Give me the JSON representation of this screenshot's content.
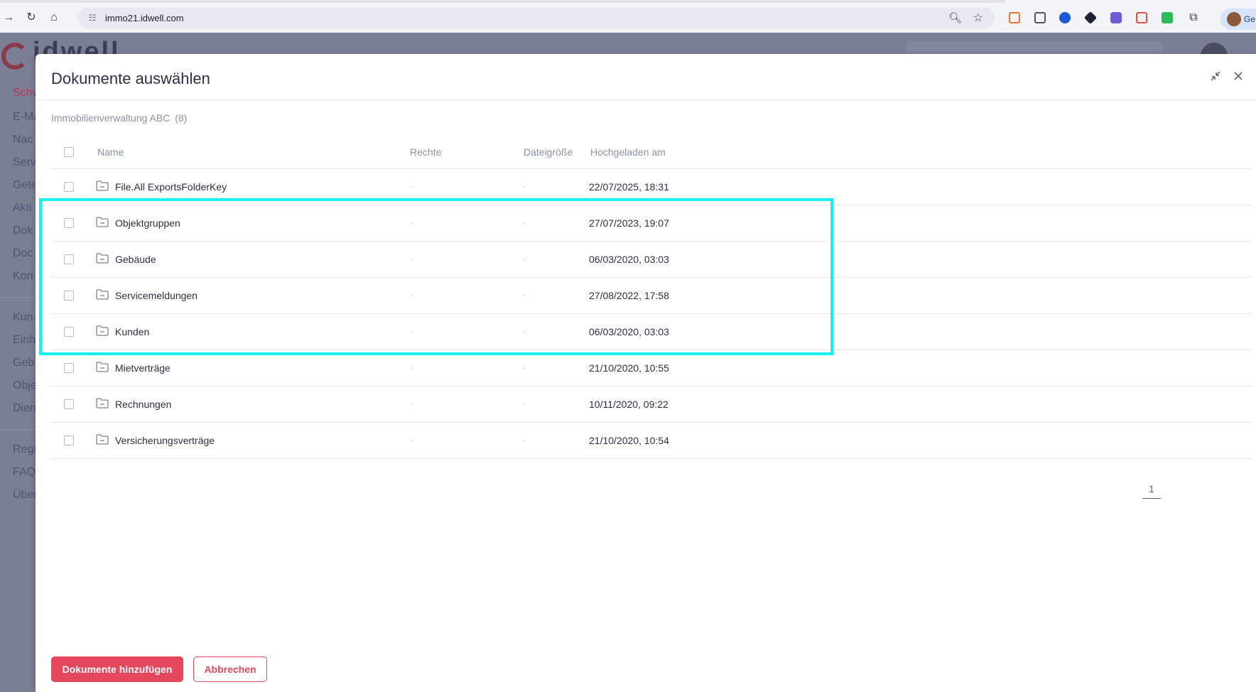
{
  "browser": {
    "url": "immo21.idwell.com",
    "profile_label": "Ge"
  },
  "app": {
    "logo_text": "idwell",
    "sidebar_items": [
      "Schw",
      "E-Ma",
      "Nac",
      "Serv",
      "Gete",
      "Akti",
      "Dok",
      "Doc",
      "Kon",
      "Kun",
      "Einh",
      "Geb",
      "Obje",
      "Dien",
      "Regi",
      "FAQ",
      "Über"
    ]
  },
  "modal": {
    "title": "Dokumente auswählen",
    "breadcrumb": {
      "label": "Immobilienverwaltung ABC",
      "count": "(8)"
    },
    "columns": {
      "name": "Name",
      "rights": "Rechte",
      "size": "Dateigröße",
      "uploaded": "Hochgeladen am"
    },
    "rows": [
      {
        "name": "File.All ExportsFolderKey",
        "rights": "-",
        "size": "-",
        "uploaded": "22/07/2025, 18:31"
      },
      {
        "name": "Objektgruppen",
        "rights": "-",
        "size": "-",
        "uploaded": "27/07/2023, 19:07"
      },
      {
        "name": "Gebäude",
        "rights": "-",
        "size": "-",
        "uploaded": "06/03/2020, 03:03"
      },
      {
        "name": "Servicemeldungen",
        "rights": "-",
        "size": "-",
        "uploaded": "27/08/2022, 17:58"
      },
      {
        "name": "Kunden",
        "rights": "-",
        "size": "-",
        "uploaded": "06/03/2020, 03:03"
      },
      {
        "name": "Mietverträge",
        "rights": "-",
        "size": "-",
        "uploaded": "21/10/2020, 10:55"
      },
      {
        "name": "Rechnungen",
        "rights": "-",
        "size": "-",
        "uploaded": "10/11/2020, 09:22"
      },
      {
        "name": "Versicherungsverträge",
        "rights": "-",
        "size": "-",
        "uploaded": "21/10/2020, 10:54"
      }
    ],
    "pagination": {
      "current_page": "1"
    },
    "buttons": {
      "add": "Dokumente hinzufügen",
      "cancel": "Abbrechen"
    }
  },
  "colors": {
    "accent": "#e5485c",
    "highlight": "#14f2f2",
    "text": "#2b2f45",
    "muted": "#8b90a7"
  }
}
